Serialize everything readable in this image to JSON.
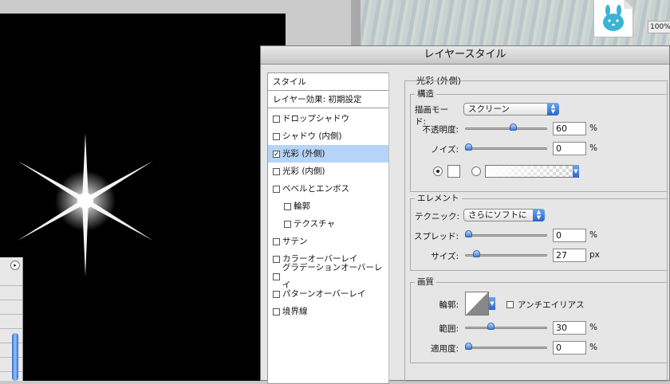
{
  "window": {
    "title": "レイヤースタイル",
    "zoom": "100%"
  },
  "style_list": {
    "header": "スタイル",
    "blend_options": "レイヤー効果: 初期設定",
    "items": [
      {
        "label": "ドロップシャドウ",
        "checked": false,
        "indent": false
      },
      {
        "label": "シャドウ (内側)",
        "checked": false,
        "indent": false
      },
      {
        "label": "光彩 (外側)",
        "checked": true,
        "indent": false,
        "selected": true
      },
      {
        "label": "光彩 (内側)",
        "checked": false,
        "indent": false
      },
      {
        "label": "ベベルとエンボス",
        "checked": false,
        "indent": false
      },
      {
        "label": "輪郭",
        "checked": false,
        "indent": true
      },
      {
        "label": "テクスチャ",
        "checked": false,
        "indent": true
      },
      {
        "label": "サテン",
        "checked": false,
        "indent": false
      },
      {
        "label": "カラーオーバーレイ",
        "checked": false,
        "indent": false
      },
      {
        "label": "グラデーションオーバーレイ",
        "checked": false,
        "indent": false
      },
      {
        "label": "パターンオーバーレイ",
        "checked": false,
        "indent": false
      },
      {
        "label": "境界線",
        "checked": false,
        "indent": false
      }
    ]
  },
  "panel": {
    "title": "光彩 (外側)",
    "structure": {
      "title": "構造",
      "blend_mode_label": "描画モード:",
      "blend_mode_value": "スクリーン",
      "opacity_label": "不透明度:",
      "opacity_value": "60",
      "opacity_slider": 60,
      "noise_label": "ノイズ:",
      "noise_value": "0",
      "noise_slider": 0,
      "unit": "%"
    },
    "elements": {
      "title": "エレメント",
      "technique_label": "テクニック:",
      "technique_value": "さらにソフトに",
      "spread_label": "スプレッド:",
      "spread_value": "0",
      "spread_slider": 0,
      "size_label": "サイズ:",
      "size_value": "27",
      "size_slider": 27,
      "size_unit": "px",
      "unit": "%"
    },
    "quality": {
      "title": "画質",
      "contour_label": "輪郭:",
      "antialias_label": "アンチエイリアス",
      "range_label": "範囲:",
      "range_value": "30",
      "range_slider": 30,
      "jitter_label": "適用度:",
      "jitter_value": "0",
      "jitter_slider": 0,
      "unit": "%"
    }
  },
  "colors": {
    "selection": "#b6d4f7",
    "accent": "#3d7fe0"
  }
}
